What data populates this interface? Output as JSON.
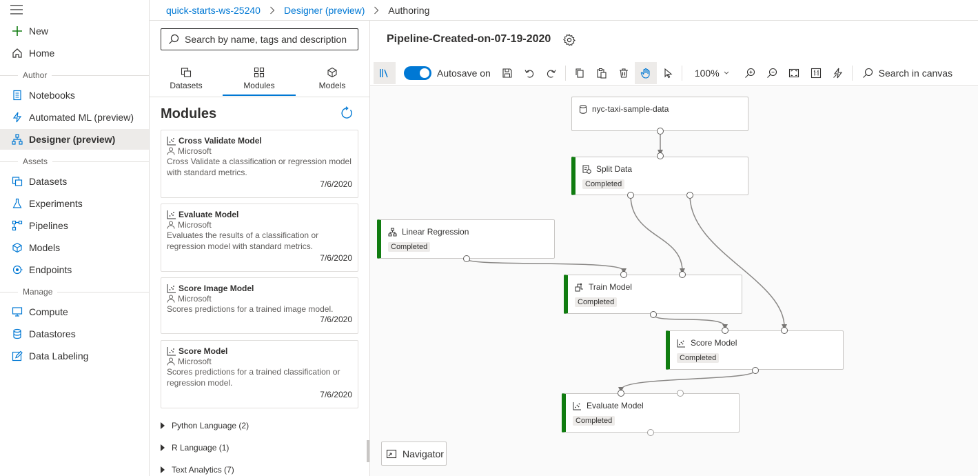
{
  "nav": {
    "items": [
      {
        "label": "New",
        "icon": "plus-icon"
      },
      {
        "label": "Home",
        "icon": "home-icon"
      },
      {
        "label": "Notebooks",
        "icon": "notebook-icon"
      },
      {
        "label": "Automated ML (preview)",
        "icon": "automl-icon"
      },
      {
        "label": "Designer (preview)",
        "icon": "designer-icon",
        "active": true
      },
      {
        "label": "Datasets",
        "icon": "datasets-icon"
      },
      {
        "label": "Experiments",
        "icon": "flask-icon"
      },
      {
        "label": "Pipelines",
        "icon": "pipelines-icon"
      },
      {
        "label": "Models",
        "icon": "cube-icon"
      },
      {
        "label": "Endpoints",
        "icon": "endpoints-icon"
      },
      {
        "label": "Compute",
        "icon": "monitor-icon"
      },
      {
        "label": "Datastores",
        "icon": "database-icon"
      },
      {
        "label": "Data Labeling",
        "icon": "edit-icon"
      }
    ],
    "sections": {
      "author": "Author",
      "assets": "Assets",
      "manage": "Manage"
    }
  },
  "breadcrumb": {
    "workspace": "quick-starts-ws-25240",
    "designer": "Designer (preview)",
    "current": "Authoring"
  },
  "palette": {
    "search_placeholder": "Search by name, tags and description",
    "tabs": [
      {
        "label": "Datasets",
        "icon": "datasets-icon"
      },
      {
        "label": "Modules",
        "icon": "modules-icon",
        "active": true
      },
      {
        "label": "Models",
        "icon": "cube-icon"
      }
    ],
    "title": "Modules",
    "modules": [
      {
        "name": "Cross Validate Model",
        "author": "Microsoft",
        "description": "Cross Validate a classification or regression model with standard metrics.",
        "date": "7/6/2020"
      },
      {
        "name": "Evaluate Model",
        "author": "Microsoft",
        "description": "Evaluates the results of a classification or regression model with standard metrics.",
        "date": "7/6/2020"
      },
      {
        "name": "Score Image Model",
        "author": "Microsoft",
        "description": "Scores predictions for a trained image model.",
        "date": "7/6/2020"
      },
      {
        "name": "Score Model",
        "author": "Microsoft",
        "description": "Scores predictions for a trained classification or regression model.",
        "date": "7/6/2020"
      }
    ],
    "categories": [
      "Python Language (2)",
      "R Language (1)",
      "Text Analytics (7)"
    ]
  },
  "pipeline": {
    "title": "Pipeline-Created-on-07-19-2020",
    "autosave_label": "Autosave on",
    "autosave_on": true,
    "zoom": "100%",
    "canvas_search_placeholder": "Search in canvas",
    "navigator_label": "Navigator",
    "nodes": [
      {
        "id": "data",
        "label": "nyc-taxi-sample-data",
        "status": "",
        "icon": "database-icon"
      },
      {
        "id": "split",
        "label": "Split Data",
        "status": "Completed",
        "icon": "split-data-icon"
      },
      {
        "id": "lr",
        "label": "Linear Regression",
        "status": "Completed",
        "icon": "hierarchy-icon"
      },
      {
        "id": "train",
        "label": "Train Model",
        "status": "Completed",
        "icon": "train-icon"
      },
      {
        "id": "score",
        "label": "Score Model",
        "status": "Completed",
        "icon": "scatter-icon"
      },
      {
        "id": "eval",
        "label": "Evaluate Model",
        "status": "Completed",
        "icon": "scatter-icon"
      }
    ]
  },
  "colors": {
    "accent": "#0078d4",
    "completed": "#107c10"
  }
}
